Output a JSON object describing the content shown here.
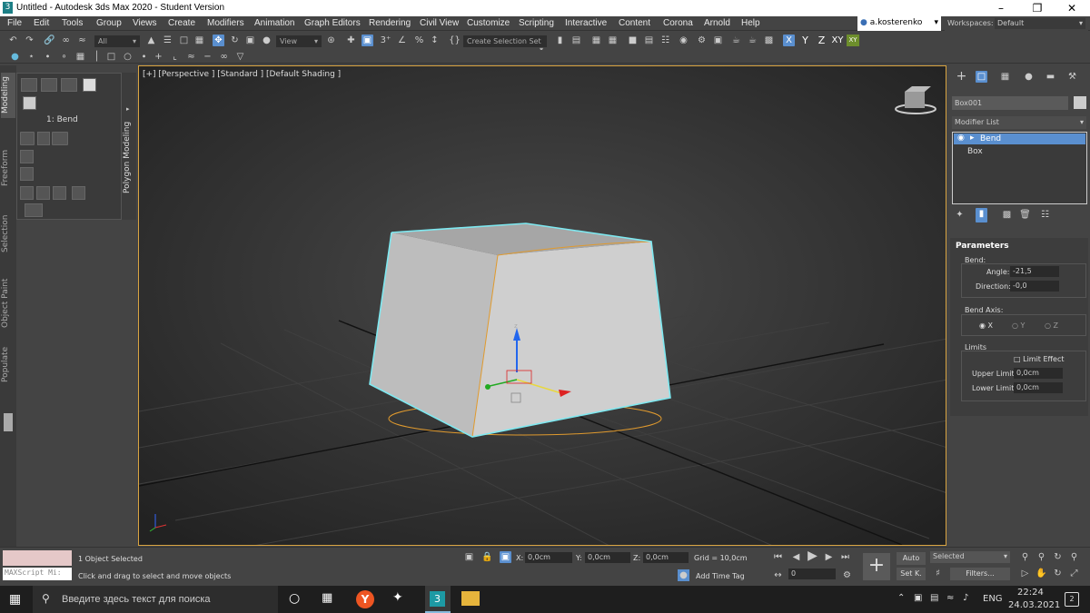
{
  "window": {
    "title": "Untitled - Autodesk 3ds Max 2020 - Student Version",
    "app_icon": "3"
  },
  "menu": [
    "File",
    "Edit",
    "Tools",
    "Group",
    "Views",
    "Create",
    "Modifiers",
    "Animation",
    "Graph Editors",
    "Rendering",
    "Civil View",
    "Customize",
    "Scripting",
    "Interactive",
    "Content",
    "Corona",
    "Arnold",
    "Help"
  ],
  "user": "a.kosterenko",
  "workspaces": {
    "label": "Workspaces:",
    "value": "Default"
  },
  "toolbar": {
    "filter": "All",
    "ref_coord": "View",
    "selection_set": "Create Selection Set",
    "axis_x": "X",
    "axis_y": "Y",
    "axis_z": "Z",
    "axis_xy": "XY"
  },
  "left_tabs": [
    "Modeling",
    "Freeform",
    "Selection",
    "Object Paint",
    "Populate"
  ],
  "ribbon": {
    "label": "1: Bend",
    "side_tab": "Polygon Modeling"
  },
  "viewport": {
    "label": "[+] [Perspective ] [Standard ] [Default Shading ]",
    "axis_z": "z",
    "axis_x": "x",
    "axis_y": "y"
  },
  "command_panel": {
    "object_name": "Box001",
    "modifier_list": "Modifier List",
    "stack": [
      "Bend",
      "Box"
    ],
    "rollout": "Parameters",
    "bend_label": "Bend:",
    "angle_label": "Angle:",
    "angle_value": "-21,5",
    "direction_label": "Direction:",
    "direction_value": "-0,0",
    "bend_axis_label": "Bend Axis:",
    "axes": [
      "X",
      "Y",
      "Z"
    ],
    "limits_label": "Limits",
    "limit_effect": "Limit Effect",
    "upper_label": "Upper Limit:",
    "upper_value": "0,0cm",
    "lower_label": "Lower Limit:",
    "lower_value": "0,0cm"
  },
  "status": {
    "maxscript": "MAXScript Mi:",
    "selected": "1 Object Selected",
    "hint": "Click and drag to select and move objects",
    "x_label": "X:",
    "x": "0,0cm",
    "y_label": "Y:",
    "y": "0,0cm",
    "z_label": "Z:",
    "z": "0,0cm",
    "grid": "Grid = 10,0cm",
    "add_time_tag": "Add Time Tag",
    "frame": "0",
    "auto": "Auto",
    "set_key": "Set K.",
    "selected_dd": "Selected",
    "filters": "Filters..."
  },
  "taskbar": {
    "search": "Введите здесь текст для поиска",
    "lang": "ENG",
    "time": "22:24",
    "date": "24.03.2021",
    "notif": "2"
  },
  "colors": {
    "accent": "#5a8fcf",
    "selection": "#7ee8f0",
    "bend_gizmo": "#e09a2e",
    "viewport_bg": "#2b2b2b"
  }
}
